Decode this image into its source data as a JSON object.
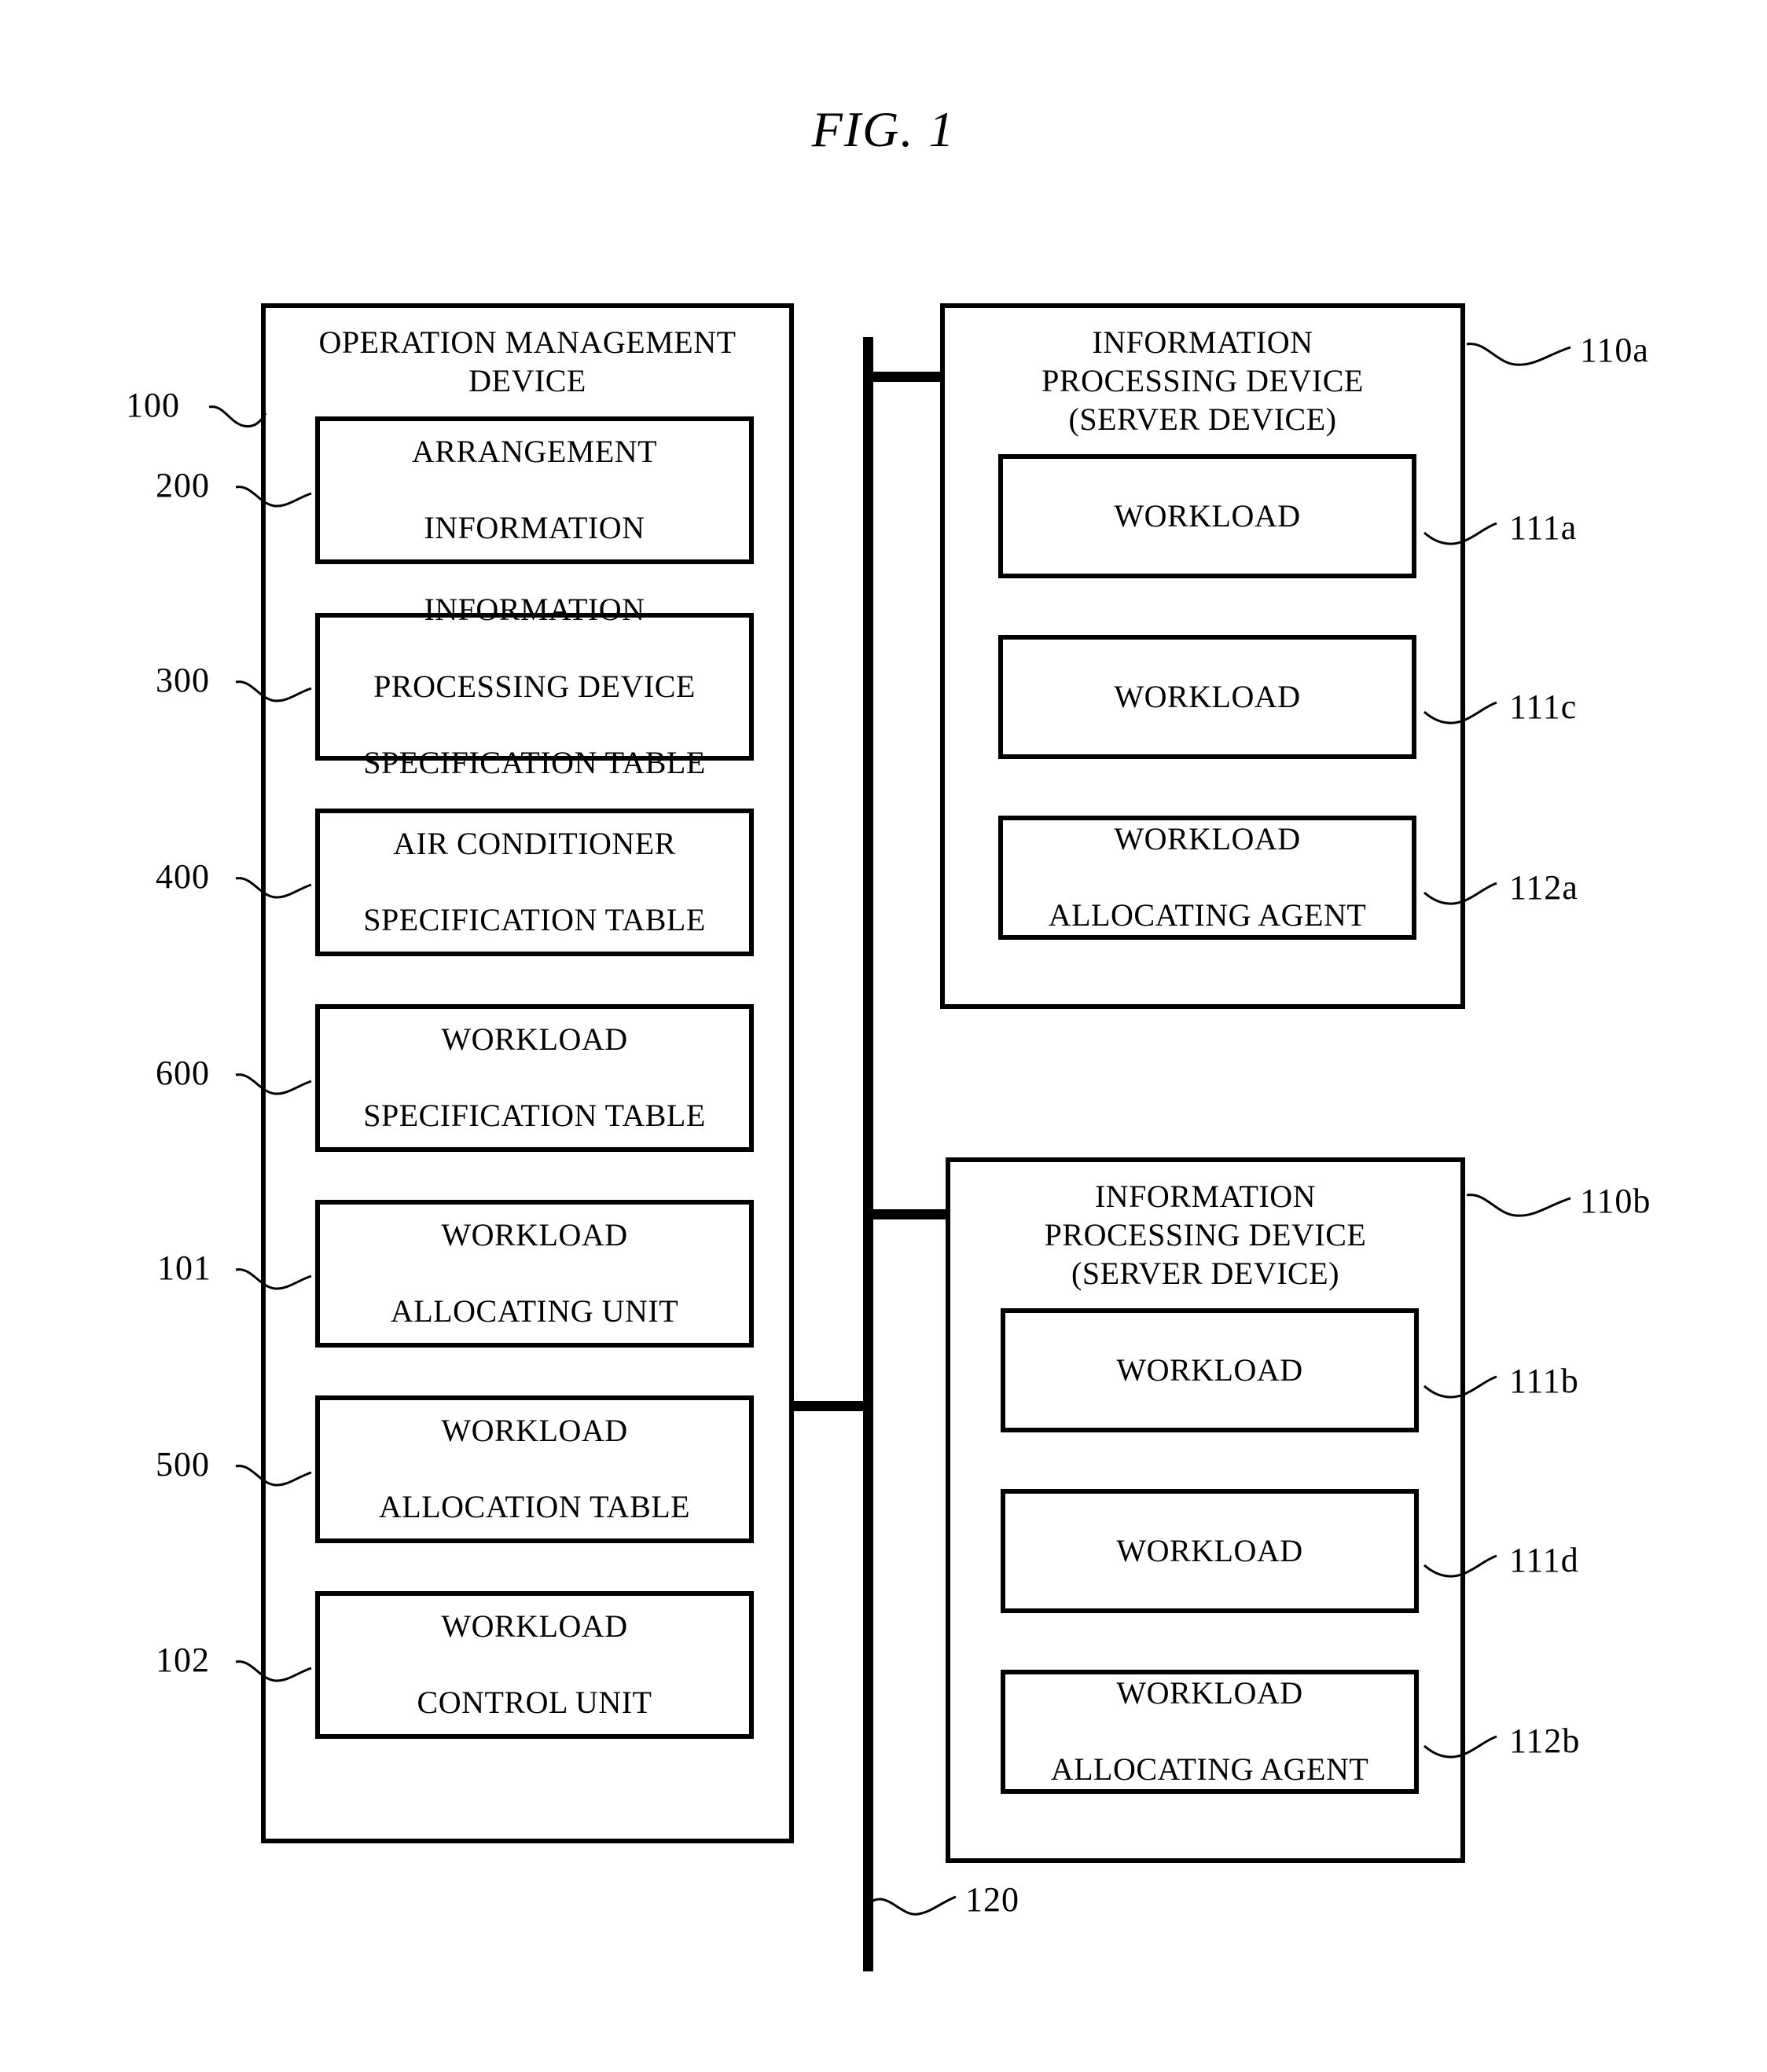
{
  "figure": {
    "title": "FIG.  1"
  },
  "left_panel": {
    "ref": "100",
    "title": "OPERATION MANAGEMENT\nDEVICE",
    "title_line1": "OPERATION MANAGEMENT",
    "title_line2": "DEVICE",
    "boxes": [
      {
        "ref": "200",
        "line1": "ARRANGEMENT",
        "line2": "INFORMATION",
        "line3": ""
      },
      {
        "ref": "300",
        "line1": "INFORMATION",
        "line2": "PROCESSING DEVICE",
        "line3": "SPECIFICATION TABLE"
      },
      {
        "ref": "400",
        "line1": "AIR CONDITIONER",
        "line2": "SPECIFICATION TABLE",
        "line3": ""
      },
      {
        "ref": "600",
        "line1": "WORKLOAD",
        "line2": "SPECIFICATION TABLE",
        "line3": ""
      },
      {
        "ref": "101",
        "line1": "WORKLOAD",
        "line2": "ALLOCATING UNIT",
        "line3": ""
      },
      {
        "ref": "500",
        "line1": "WORKLOAD",
        "line2": "ALLOCATION TABLE",
        "line3": ""
      },
      {
        "ref": "102",
        "line1": "WORKLOAD",
        "line2": "CONTROL UNIT",
        "line3": ""
      }
    ]
  },
  "right_panel_top": {
    "ref": "110a",
    "title_line1": "INFORMATION",
    "title_line2": "PROCESSING DEVICE",
    "title_line3": "(SERVER DEVICE)",
    "boxes": [
      {
        "ref": "111a",
        "line1": "WORKLOAD",
        "line2": ""
      },
      {
        "ref": "111c",
        "line1": "WORKLOAD",
        "line2": ""
      },
      {
        "ref": "112a",
        "line1": "WORKLOAD",
        "line2": "ALLOCATING AGENT"
      }
    ]
  },
  "right_panel_bottom": {
    "ref": "110b",
    "title_line1": "INFORMATION",
    "title_line2": "PROCESSING DEVICE",
    "title_line3": "(SERVER DEVICE)",
    "boxes": [
      {
        "ref": "111b",
        "line1": "WORKLOAD",
        "line2": ""
      },
      {
        "ref": "111d",
        "line1": "WORKLOAD",
        "line2": ""
      },
      {
        "ref": "112b",
        "line1": "WORKLOAD",
        "line2": "ALLOCATING AGENT"
      }
    ]
  },
  "network": {
    "ref": "120"
  }
}
